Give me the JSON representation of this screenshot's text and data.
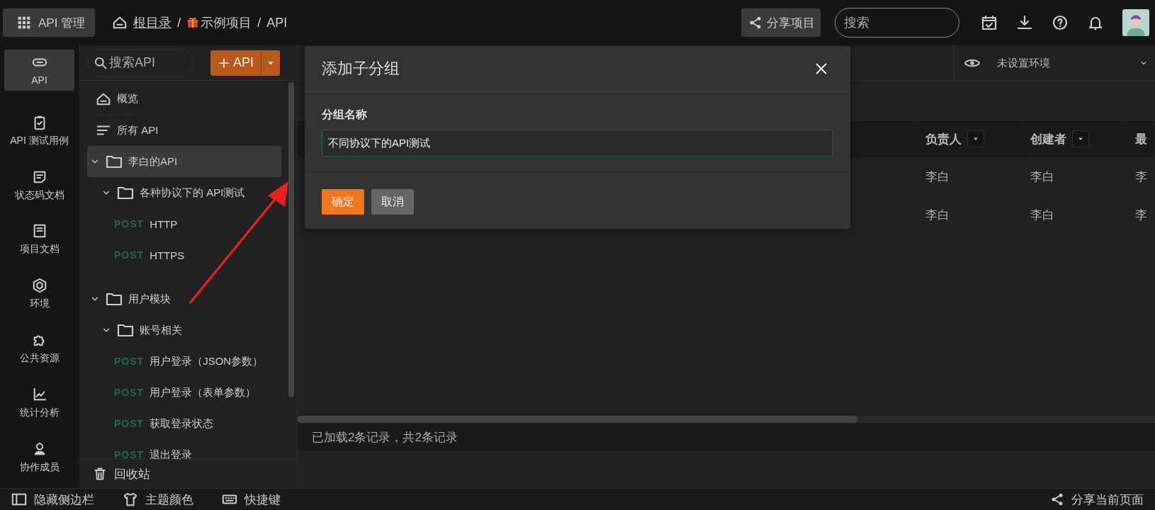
{
  "topbar": {
    "menu_button": "API 管理",
    "breadcrumb": [
      {
        "kind": "root",
        "label": "根目录"
      },
      {
        "kind": "separator",
        "label": "/"
      },
      {
        "kind": "project",
        "label": "示例项目"
      },
      {
        "kind": "separator",
        "label": "/"
      },
      {
        "kind": "plain",
        "label": "API"
      }
    ],
    "share_button": "分享项目",
    "search": {
      "placeholder": "搜索"
    }
  },
  "rail": [
    {
      "kind": "link",
      "label": "API",
      "selected": true
    },
    {
      "kind": "clipboard",
      "label": "API 测试用例",
      "selected": false
    },
    {
      "kind": "doc",
      "label": "状态码文档",
      "selected": false
    },
    {
      "kind": "book",
      "label": "项目文档",
      "selected": false
    },
    {
      "kind": "cube",
      "label": "环境",
      "selected": false
    },
    {
      "kind": "puzzle",
      "label": "公共资源",
      "selected": false
    },
    {
      "kind": "chart",
      "label": "统计分析",
      "selected": false
    },
    {
      "kind": "user",
      "label": "协作成员",
      "selected": false
    }
  ],
  "tree": {
    "search": {
      "placeholder": "搜索API"
    },
    "add_button": "API",
    "items": [
      {
        "kind": "overview",
        "label": "概览",
        "selected": false
      },
      {
        "kind": "all",
        "label": "所有 API",
        "selected": false
      },
      {
        "kind": "folder",
        "label": "李白的API",
        "selected": true,
        "expanded": true,
        "children": [
          {
            "kind": "folder",
            "label": "各种协议下的 API测试",
            "selected": false,
            "expanded": true,
            "children": [
              {
                "kind": "api",
                "method": "POST",
                "label": "HTTP",
                "selected": false
              },
              {
                "kind": "api",
                "method": "POST",
                "label": "HTTPS",
                "selected": false
              }
            ]
          }
        ]
      },
      {
        "kind": "folder",
        "label": "用户模块",
        "selected": false,
        "expanded": true,
        "children": [
          {
            "kind": "folder",
            "label": "账号相关",
            "selected": false,
            "expanded": true,
            "children": [
              {
                "kind": "api",
                "method": "POST",
                "label": "用户登录（JSON参数）",
                "selected": false
              },
              {
                "kind": "api",
                "method": "POST",
                "label": "用户登录（表单参数）",
                "selected": false
              },
              {
                "kind": "api",
                "method": "POST",
                "label": "获取登录状态",
                "selected": false
              },
              {
                "kind": "api",
                "method": "POST",
                "label": "退出登录",
                "selected": false
              }
            ]
          }
        ]
      }
    ],
    "trash": "回收站"
  },
  "environment": "未设置环境",
  "table": {
    "columns": [
      "负责人",
      "创建者",
      "最"
    ],
    "rows": [
      [
        "李白",
        "李白",
        "李"
      ],
      [
        "李白",
        "李白",
        "李"
      ]
    ]
  },
  "status": "已加载2条记录，共2条记录",
  "dialog": {
    "title": "添加子分组",
    "field_label": "分组名称",
    "field_value": "不同协议下的API测试",
    "buttons": [
      {
        "kind": "primary",
        "label": "确定"
      },
      {
        "kind": "secondary",
        "label": "取消"
      }
    ]
  },
  "bottombar": {
    "items": [
      {
        "kind": "sidebar",
        "label": "隐藏侧边栏"
      },
      {
        "kind": "shirt",
        "label": "主题颜色"
      },
      {
        "kind": "keyboard",
        "label": "快捷键"
      }
    ],
    "share_page": "分享当前页面"
  }
}
